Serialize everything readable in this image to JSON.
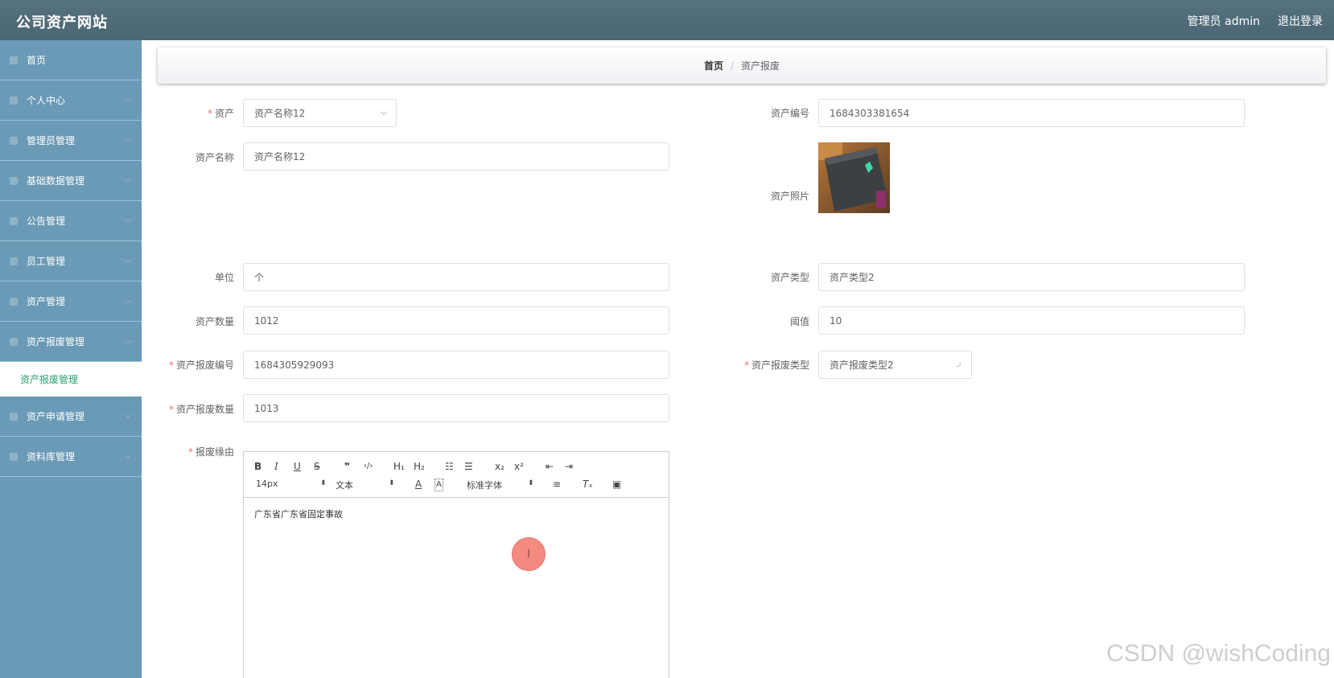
{
  "header": {
    "title": "公司资产网站",
    "user": "管理员 admin",
    "logout": "退出登录"
  },
  "sidebar": {
    "items": [
      {
        "label": "首页"
      },
      {
        "label": "个人中心"
      },
      {
        "label": "管理员管理"
      },
      {
        "label": "基础数据管理"
      },
      {
        "label": "公告管理"
      },
      {
        "label": "员工管理"
      },
      {
        "label": "资产管理"
      },
      {
        "label": "资产报废管理"
      },
      {
        "label": "资产申请管理"
      },
      {
        "label": "资料库管理"
      }
    ],
    "active_sub": "资产报废管理"
  },
  "breadcrumb": {
    "home": "首页",
    "separator": "/",
    "current": "资产报废"
  },
  "form": {
    "asset": {
      "label": "资产",
      "value": "资产名称12"
    },
    "asset_code": {
      "label": "资产编号",
      "value": "1684303381654"
    },
    "asset_name": {
      "label": "资产名称",
      "value": "资产名称12"
    },
    "asset_photo": {
      "label": "资产照片"
    },
    "unit": {
      "label": "单位",
      "value": "个"
    },
    "asset_type": {
      "label": "资产类型",
      "value": "资产类型2"
    },
    "asset_qty": {
      "label": "资产数量",
      "value": "1012"
    },
    "threshold": {
      "label": "阈值",
      "value": "10"
    },
    "scrap_code": {
      "label": "资产报废编号",
      "value": "1684305929093"
    },
    "scrap_type": {
      "label": "资产报废类型",
      "value": "资产报废类型2"
    },
    "scrap_qty": {
      "label": "资产报废数量",
      "value": "1013"
    },
    "reason": {
      "label": "报废缘由"
    }
  },
  "editor": {
    "font_size": "14px",
    "text_type": "文本",
    "font_family": "标准字体",
    "content": "广东省广东省固定事故",
    "buttons": {
      "bold": "B",
      "italic": "I",
      "underline": "U",
      "strike": "S",
      "quote": "❞",
      "code": "‹/›",
      "h1": "H₁",
      "h2": "H₂",
      "ol": "☷",
      "ul": "☰",
      "sub": "x₂",
      "sup": "x²",
      "outdent": "⇤",
      "indent": "⇥",
      "color": "A",
      "bg": "A",
      "align": "≡",
      "clean": "Tₓ",
      "image": "▣",
      "updown": "⬍"
    }
  },
  "cursor_glyph": "I",
  "watermark": "CSDN @wishCoding"
}
